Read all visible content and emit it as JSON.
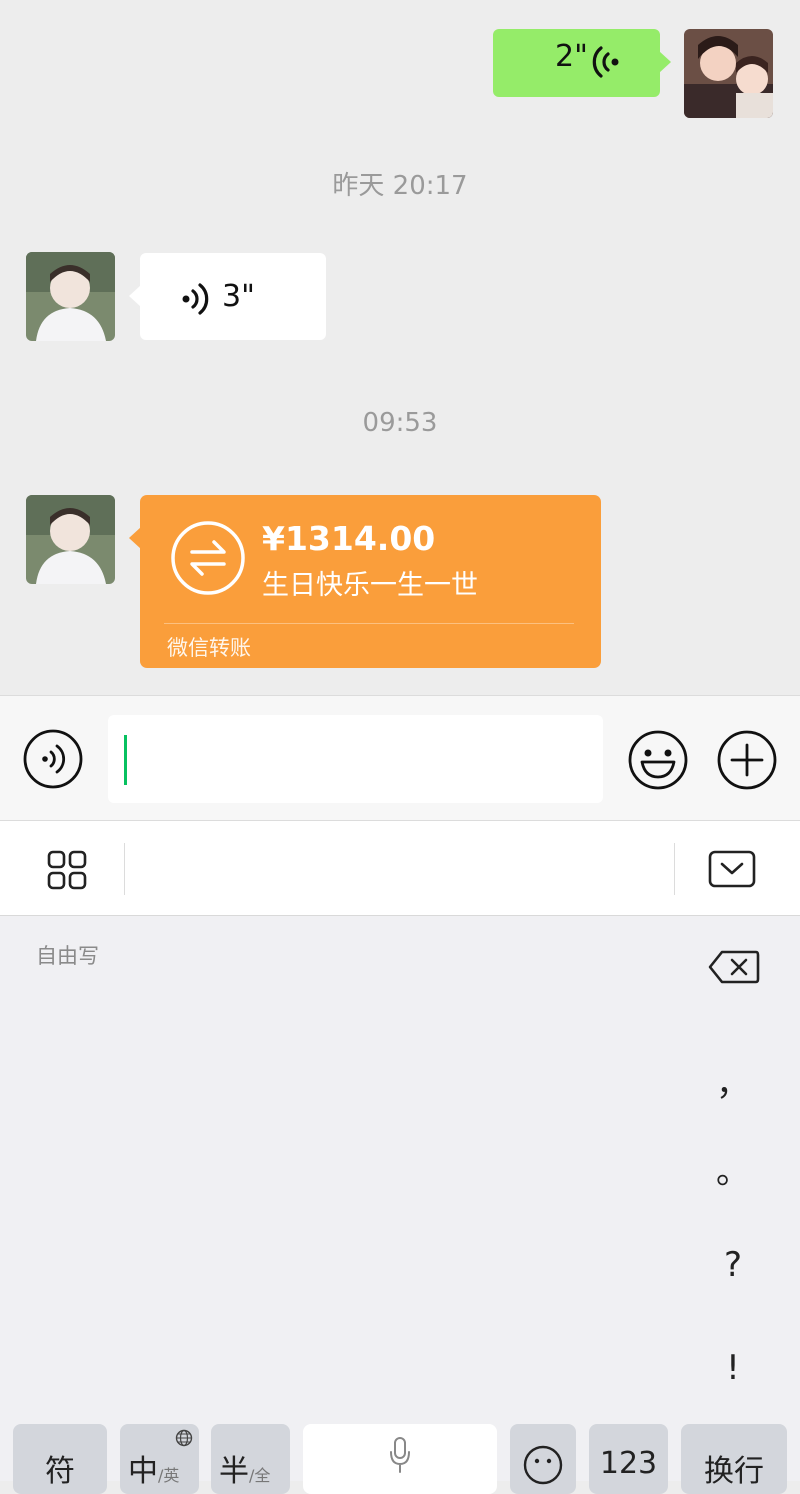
{
  "chat": {
    "messages": [
      {
        "side": "right",
        "kind": "voice",
        "duration": "2\""
      },
      {
        "kind": "time",
        "text": "昨天 20:17"
      },
      {
        "side": "left",
        "kind": "voice",
        "duration": "3\""
      },
      {
        "kind": "time",
        "text": "09:53"
      },
      {
        "side": "left",
        "kind": "transfer",
        "amount": "¥1314.00",
        "note": "生日快乐一生一世",
        "footer": "微信转账"
      }
    ]
  },
  "input_bar": {
    "icons": [
      "voice-mode-icon",
      "emoji-icon",
      "plus-icon"
    ]
  },
  "keyboard": {
    "toolbar_icons": [
      "grid-icon",
      "keyboard-collapse-icon"
    ],
    "handwriting_label": "自由写",
    "punctuation": [
      "，",
      "。",
      "?",
      "!"
    ],
    "bottom_keys": {
      "symbol": "符",
      "chinese": "中",
      "chinese_sub": "/英",
      "half": "半",
      "half_sub": "/全",
      "number": "123",
      "enter": "换行"
    }
  },
  "colors": {
    "green_bubble": "#95ec69",
    "transfer_orange": "#fa9e3b",
    "caret": "#07c160"
  }
}
